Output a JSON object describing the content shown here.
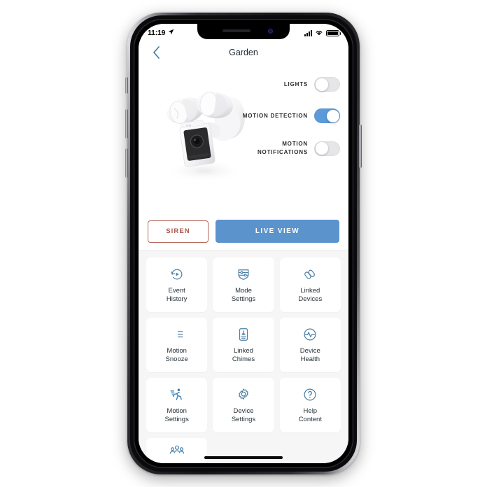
{
  "status_bar": {
    "time": "11:19",
    "location_icon": "location-arrow-icon",
    "signal_icon": "cellular-signal-icon",
    "wifi_icon": "wifi-icon",
    "battery_icon": "battery-full-icon"
  },
  "nav": {
    "back_icon": "chevron-left-icon",
    "title": "Garden"
  },
  "hero": {
    "device_image_alt": "floodlight-camera-image",
    "toggles": [
      {
        "label": "LIGHTS",
        "state": "off",
        "icon": "toggle-switch"
      },
      {
        "label": "MOTION DETECTION",
        "state": "on",
        "icon": "toggle-switch"
      },
      {
        "label": "MOTION NOTIFICATIONS",
        "state": "off",
        "icon": "toggle-switch"
      }
    ]
  },
  "actions": {
    "siren_label": "SIREN",
    "live_view_label": "LIVE VIEW"
  },
  "grid": {
    "tiles": [
      {
        "label": "Event\nHistory",
        "line1": "Event",
        "line2": "History",
        "icon": "event-history-icon"
      },
      {
        "label": "Mode Settings",
        "line1": "Mode",
        "line2": "Settings",
        "icon": "mode-settings-icon"
      },
      {
        "label": "Linked Devices",
        "line1": "Linked",
        "line2": "Devices",
        "icon": "linked-devices-icon"
      },
      {
        "label": "Motion Snooze",
        "line1": "Motion",
        "line2": "Snooze",
        "icon": "motion-snooze-icon"
      },
      {
        "label": "Linked Chimes",
        "line1": "Linked",
        "line2": "Chimes",
        "icon": "linked-chimes-icon"
      },
      {
        "label": "Device Health",
        "line1": "Device",
        "line2": "Health",
        "icon": "device-health-icon"
      },
      {
        "label": "Motion Settings",
        "line1": "Motion",
        "line2": "Settings",
        "icon": "motion-settings-icon"
      },
      {
        "label": "Device Settings",
        "line1": "Device",
        "line2": "Settings",
        "icon": "device-settings-icon"
      },
      {
        "label": "Help Content",
        "line1": "Help",
        "line2": "Content",
        "icon": "help-content-icon"
      },
      {
        "label": "Shared Users",
        "line1": "",
        "line2": "",
        "icon": "shared-users-icon"
      }
    ]
  },
  "colors": {
    "accent_blue": "#5b93cc",
    "toggle_on": "#5b9bd9",
    "siren_red": "#b4685c",
    "icon_blue": "#4a7fa5",
    "grid_bg": "#f6f6f7",
    "title_text": "#1d2a33"
  }
}
